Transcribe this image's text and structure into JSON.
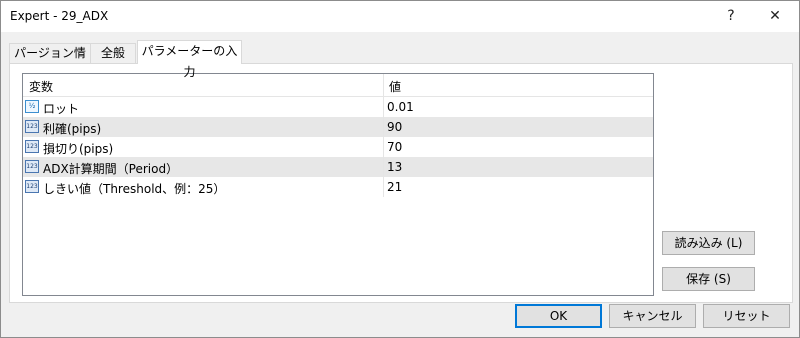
{
  "window": {
    "title": "Expert - 29_ADX",
    "help_glyph": "?",
    "close_glyph": "✕"
  },
  "tabs": [
    {
      "label": "パージョン情報"
    },
    {
      "label": "全般"
    },
    {
      "label": "パラメーターの入力"
    }
  ],
  "table": {
    "headers": {
      "name": "変数",
      "value": "値"
    },
    "rows": [
      {
        "icon": "½",
        "name": "ロット",
        "value": "0.01"
      },
      {
        "icon": "123",
        "name": "利確(pips)",
        "value": "90"
      },
      {
        "icon": "123",
        "name": "損切り(pips)",
        "value": "70"
      },
      {
        "icon": "123",
        "name": "ADX計算期間（Period）",
        "value": "13"
      },
      {
        "icon": "123",
        "name": "しきい値（Threshold、例：25）",
        "value": "21"
      }
    ]
  },
  "buttons": {
    "load": "読み込み (L)",
    "save": "保存 (S)",
    "ok": "OK",
    "cancel": "キャンセル",
    "reset": "リセット"
  }
}
